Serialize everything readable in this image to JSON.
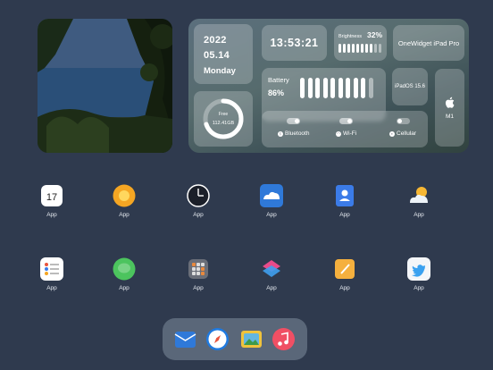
{
  "widget": {
    "year": "2022",
    "date": "05.14",
    "weekday": "Monday",
    "time": "13:53:21",
    "brightness_label": "Brightness",
    "brightness_value": "32%",
    "device": "OneWidget iPad Pro",
    "battery_label": "Battery",
    "battery_value": "86%",
    "battery_level": 0.86,
    "brightness_level": 0.32,
    "os": "iPadOS 15.6",
    "chip": "M1",
    "storage_label": "Free",
    "storage_value": "112.41GB",
    "storage_fraction": 0.7,
    "bluetooth_label": "Bluetooth",
    "wifi_label": "Wi-Fi",
    "cellular_label": "Cellular"
  },
  "apps_row1": [
    {
      "label": "App",
      "icon": "calendar-icon",
      "text": "17"
    },
    {
      "label": "App",
      "icon": "sun-icon"
    },
    {
      "label": "App",
      "icon": "clock-icon"
    },
    {
      "label": "App",
      "icon": "cloud-drive-icon"
    },
    {
      "label": "App",
      "icon": "contacts-icon"
    },
    {
      "label": "App",
      "icon": "weather-icon"
    }
  ],
  "apps_row2": [
    {
      "label": "App",
      "icon": "reminders-icon"
    },
    {
      "label": "App",
      "icon": "messages-icon"
    },
    {
      "label": "App",
      "icon": "calculator-icon"
    },
    {
      "label": "App",
      "icon": "shortcuts-icon"
    },
    {
      "label": "App",
      "icon": "notes-icon"
    },
    {
      "label": "App",
      "icon": "twitter-icon"
    }
  ],
  "dock": [
    "mail-icon",
    "safari-icon",
    "photos-icon",
    "music-icon"
  ],
  "colors": {
    "background": "#2f3a4e",
    "dock": "#5a6779",
    "tile": "rgba(255,255,255,0.22)"
  }
}
